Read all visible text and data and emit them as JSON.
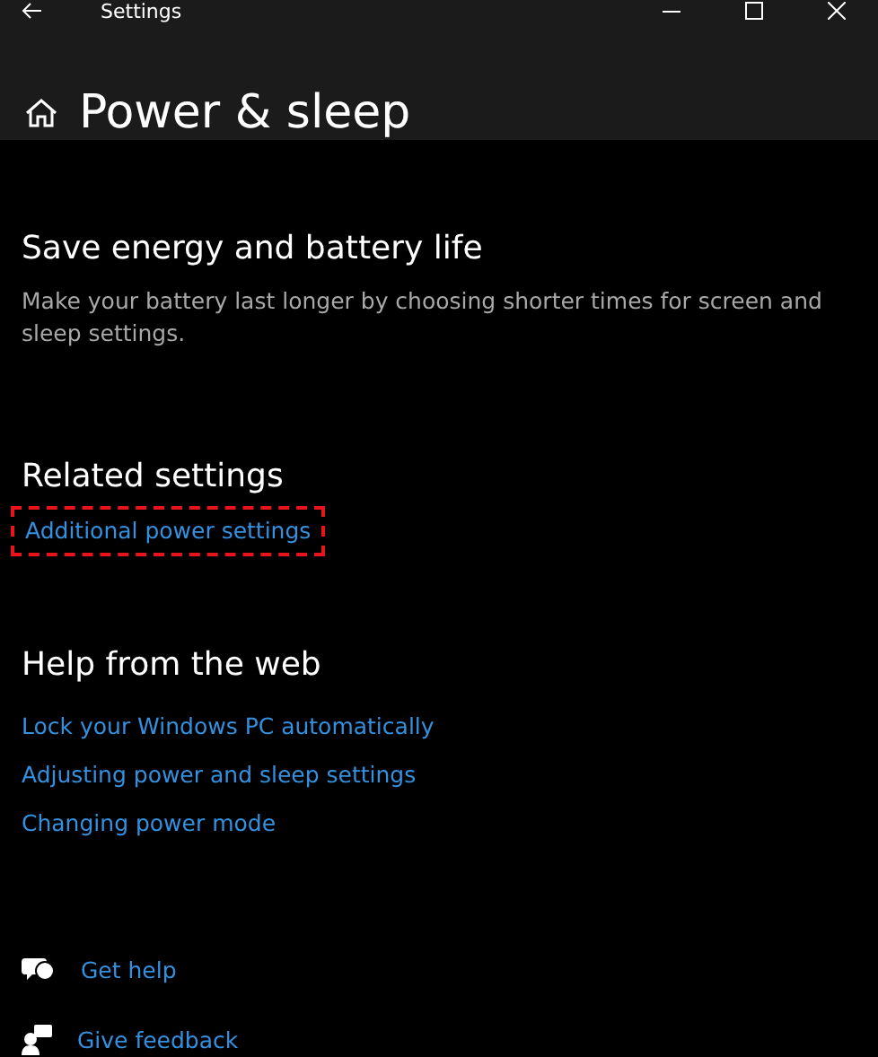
{
  "window": {
    "title": "Settings"
  },
  "page": {
    "title": "Power & sleep"
  },
  "sections": [
    {
      "heading": "Save energy and battery life",
      "description": "Make your battery last longer by choosing shorter times for screen and sleep settings."
    },
    {
      "heading": "Related settings",
      "links": [
        {
          "label": "Additional power settings",
          "highlighted": true
        }
      ]
    },
    {
      "heading": "Help from the web",
      "links": [
        {
          "label": "Lock your Windows PC automatically",
          "highlighted": false
        },
        {
          "label": "Adjusting power and sleep settings",
          "highlighted": false
        },
        {
          "label": "Changing power mode",
          "highlighted": false
        }
      ]
    }
  ],
  "footer_links": [
    {
      "kind": "help",
      "label": "Get help"
    },
    {
      "kind": "feedback",
      "label": "Give feedback"
    }
  ]
}
